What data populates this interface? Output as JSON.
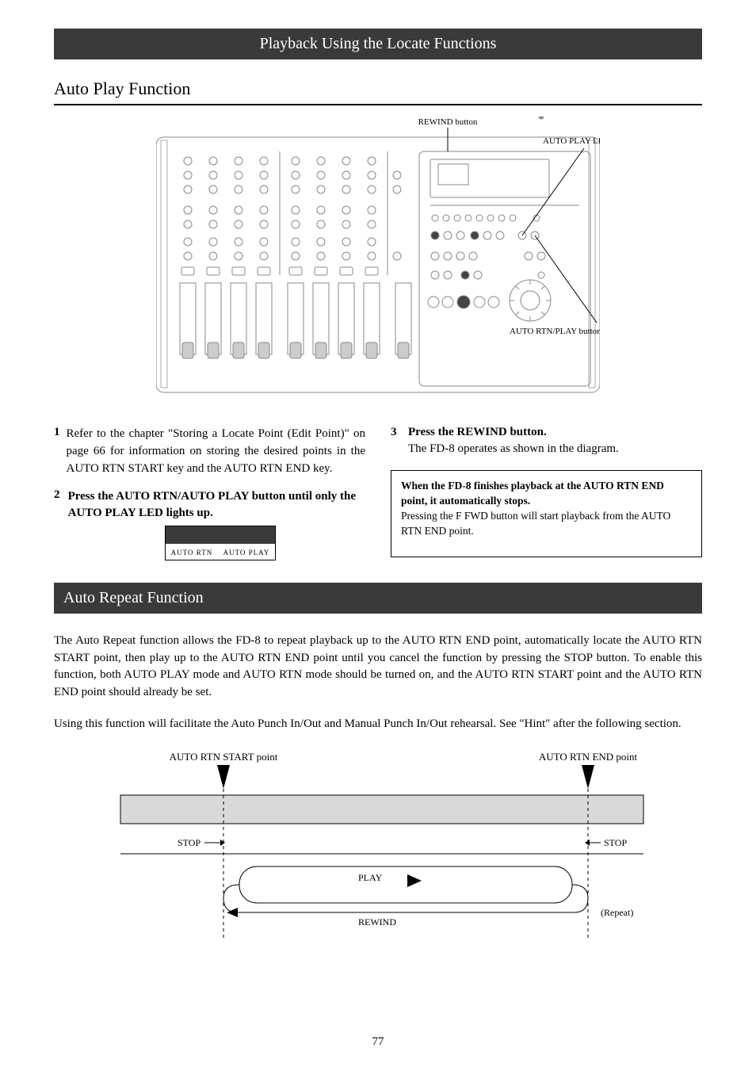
{
  "topbar": {
    "title": "Playback Using the Locate Functions"
  },
  "subheader": {
    "title": "Auto Play Function"
  },
  "mixer_callouts": {
    "rewind": "REWIND button",
    "autoplay": "AUTO PLAY LED",
    "autortn": "AUTO RTN/PLAY button"
  },
  "leftcol": {
    "step1_label": "1",
    "step1_text": "Refer to the chapter \"Storing a Locate Point (Edit Point)\" on page 66 for information on storing the desired points in the AUTO RTN START key and the AUTO RTN END key.",
    "step2_label": "2",
    "step2_text": "Press the AUTO RTN/AUTO PLAY button until only the AUTO PLAY LED lights up."
  },
  "lcd": {
    "left": "AUTO RTN",
    "right": "AUTO PLAY"
  },
  "rightcol": {
    "step3_label": "3",
    "step3_text": "Press the REWIND button.",
    "result": "The FD-8 operates as shown in the diagram."
  },
  "rightbox_lines": {
    "l1": "When the FD-8 finishes playback at the AUTO RTN END point, it automatically stops.",
    "l2": "Pressing the F FWD button will start playback from the AUTO RTN END point."
  },
  "repeat": {
    "header": "Auto Repeat Function",
    "p1": "The Auto Repeat function allows the FD-8 to repeat playback up to the AUTO RTN END point, automatically locate the AUTO RTN START point, then play up to the AUTO RTN END point until you cancel the function by pressing the STOP button.  To enable this function, both AUTO PLAY mode and AUTO RTN mode should be turned on, and the AUTO RTN START point and the AUTO RTN END point should already be set.",
    "p2": "Using this function will facilitate the Auto Punch In/Out and Manual Punch In/Out rehearsal. See \"Hint\" after the following section."
  },
  "diagram": {
    "start_label": "AUTO RTN START point",
    "end_label": "AUTO RTN END point",
    "stop_label": "STOP",
    "play_label": "PLAY",
    "rwd_label": "REWIND",
    "repeat_note": "(Repeat)"
  },
  "page_number": "77"
}
